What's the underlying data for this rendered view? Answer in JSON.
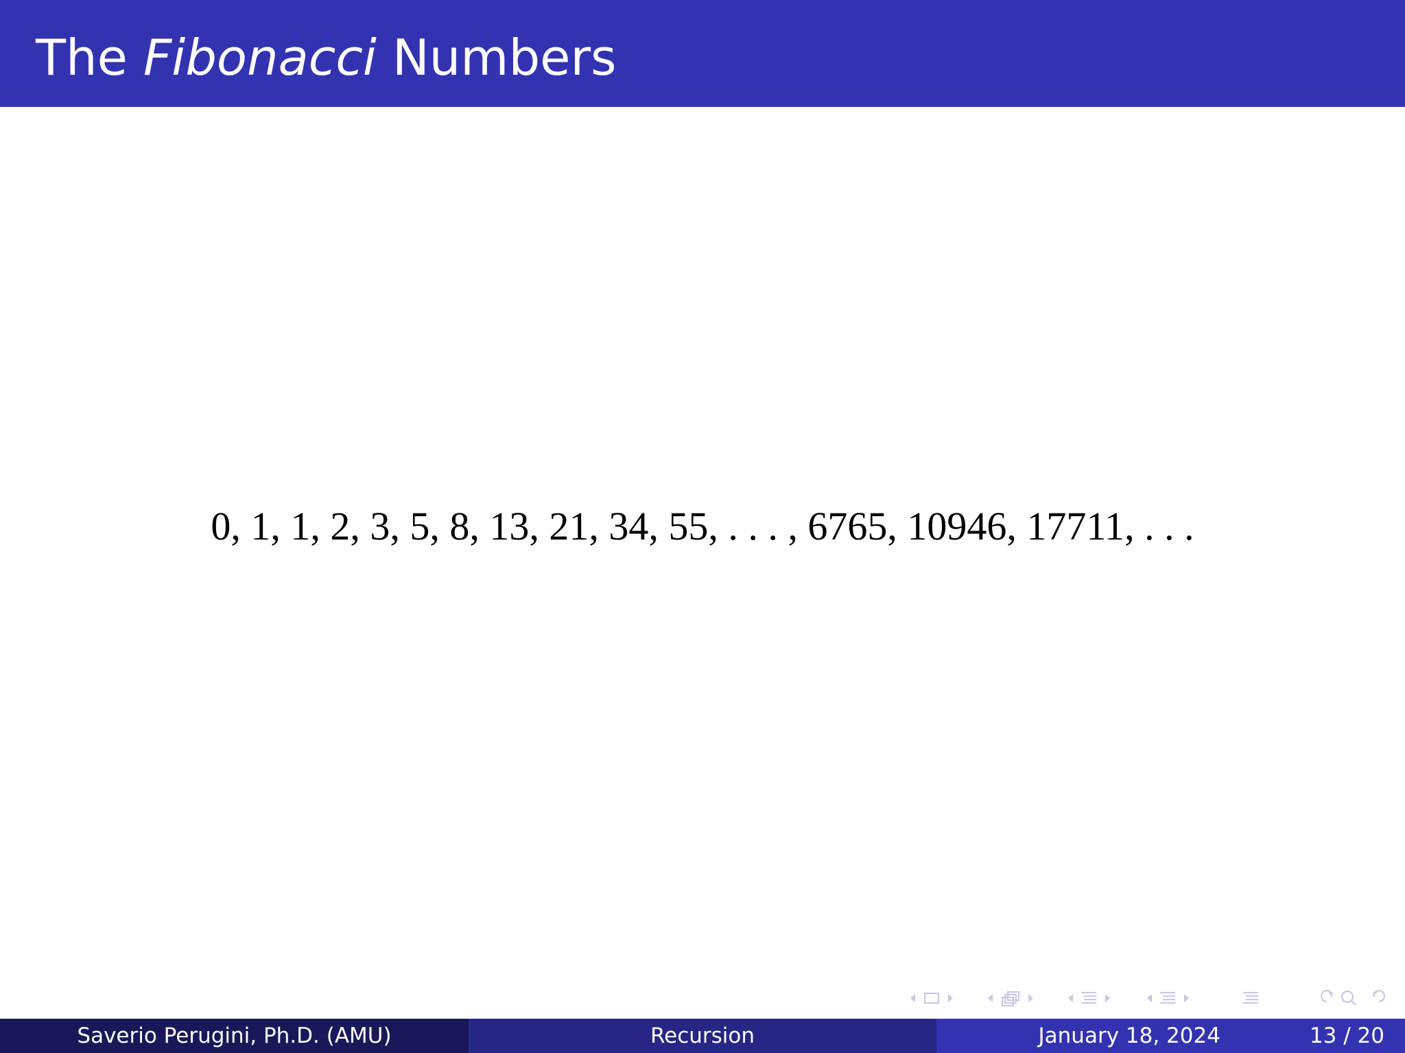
{
  "slide": {
    "title_prefix": "The",
    "title_italic": "Fibonacci",
    "title_suffix": "Numbers",
    "sequence": "0, 1, 1, 2, 3, 5, 8, 13, 21, 34, 55, . . . , 6765, 10946, 17711, . . ."
  },
  "footer": {
    "author": "Saverio Perugini, Ph.D.  (AMU)",
    "title": "Recursion",
    "date": "January 18, 2024",
    "page": "13 / 20"
  },
  "navigation": {
    "icons": [
      "nav-frame-prev-icon",
      "nav-frame-icon",
      "nav-frame-next-icon",
      "nav-subsection-prev-icon",
      "nav-subsection-icon",
      "nav-subsection-next-icon",
      "nav-section-prev-icon",
      "nav-section-icon",
      "nav-section-next-icon",
      "nav-document-icon",
      "nav-search-icon",
      "nav-back-forward-icon"
    ],
    "color": "#c8c8e8"
  },
  "colors": {
    "title_bar": "#3333b2",
    "footer_left": "#191959",
    "footer_middle": "#262686",
    "footer_right": "#3333b2"
  }
}
